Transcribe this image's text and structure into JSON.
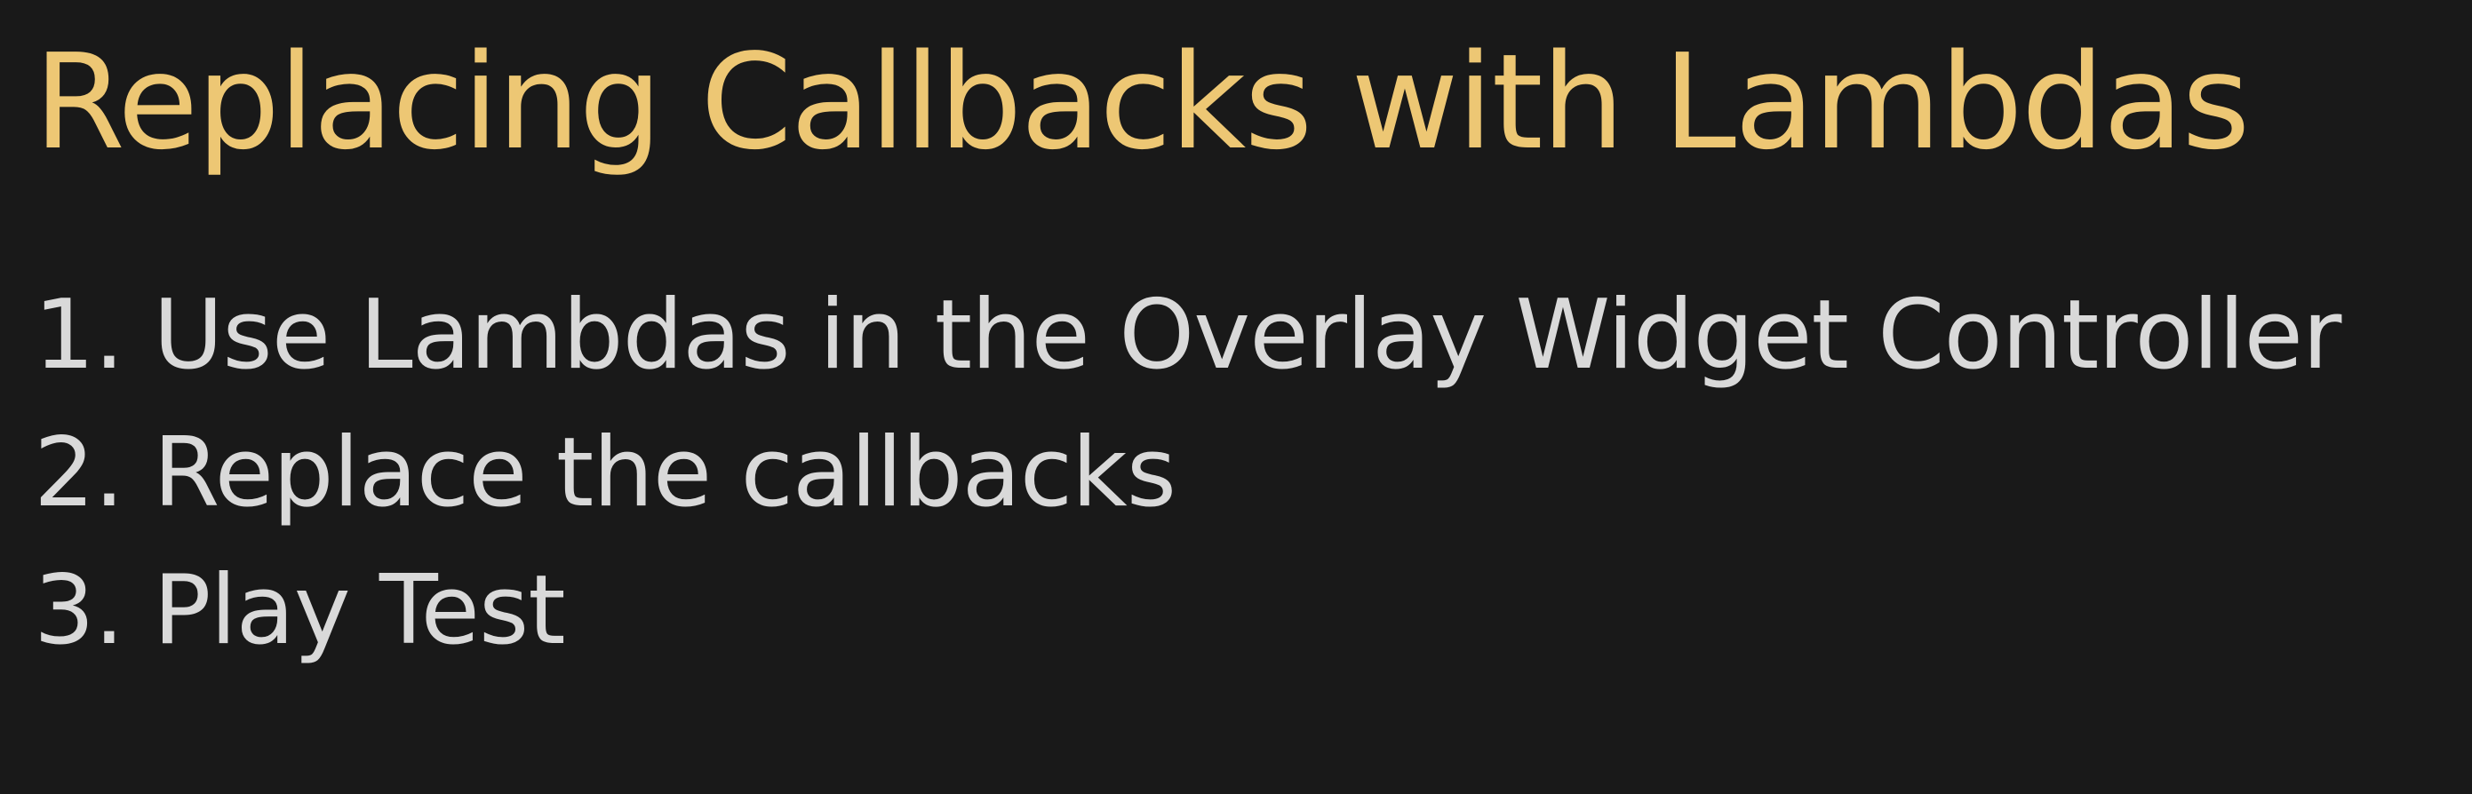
{
  "slide": {
    "title": "Replacing Callbacks with Lambdas",
    "steps": [
      "1. Use Lambdas in the Overlay Widget Controller",
      "2. Replace the callbacks",
      "3. Play Test"
    ]
  },
  "colors": {
    "background": "#191919",
    "title": "#edc774",
    "body_text": "#d9d9d9"
  }
}
